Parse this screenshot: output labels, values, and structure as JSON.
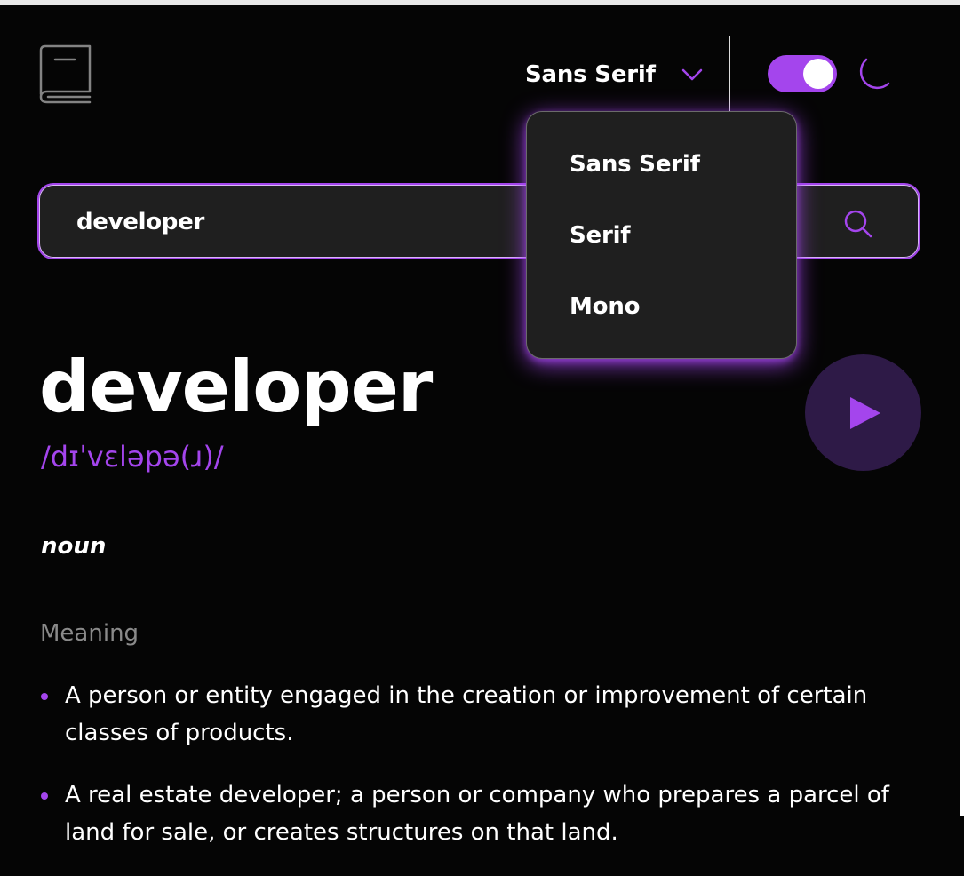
{
  "header": {
    "font_selector": {
      "selected": "Sans Serif"
    },
    "theme": {
      "dark_mode": true
    }
  },
  "font_menu": {
    "options": [
      "Sans Serif",
      "Serif",
      "Mono"
    ]
  },
  "search": {
    "value": "developer"
  },
  "word": {
    "title": "developer",
    "phonetic": "/dɪˈvɛləpə(ɹ)/"
  },
  "meaning_block": {
    "part_of_speech": "noun",
    "heading": "Meaning",
    "definitions": [
      "A person or entity engaged in the creation or improvement of certain classes of products.",
      "A real estate developer; a person or company who prepares a parcel of land for sale, or creates structures on that land."
    ]
  },
  "colors": {
    "accent": "#a445ed",
    "background": "#050505",
    "surface": "#1f1f1f",
    "muted_text": "#8a8a8a",
    "play_button_bg": "#2e1a47"
  },
  "icons": {
    "logo": "book-icon",
    "dropdown": "chevron-down-icon",
    "theme": "moon-icon",
    "search": "search-icon",
    "play": "play-icon"
  }
}
